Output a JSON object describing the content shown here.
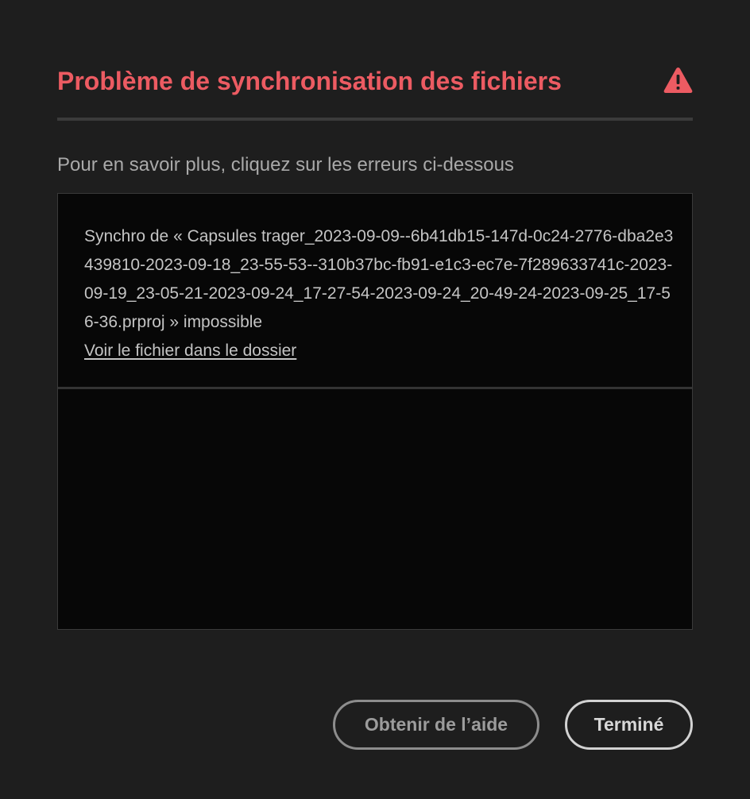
{
  "dialog": {
    "title": "Problème de synchronisation des fichiers",
    "title_color": "#ec5b62",
    "warning_icon": "alert-triangle-icon",
    "subtitle": "Pour en savoir plus, cliquez sur les erreurs ci-dessous",
    "errors": [
      {
        "message": "Synchro de « Capsules trager_2023-09-09--6b41db15-147d-0c24-2776-dba2e3439810-2023-09-18_23-55-53--310b37bc-fb91-e1c3-ec7e-7f289633741c-2023-09-19_23-05-21-2023-09-24_17-27-54-2023-09-24_20-49-24-2023-09-25_17-56-36.prproj » impossible",
        "link_label": "Voir le fichier dans le dossier"
      }
    ],
    "buttons": {
      "help_label": "Obtenir de l’aide",
      "done_label": "Terminé"
    }
  }
}
